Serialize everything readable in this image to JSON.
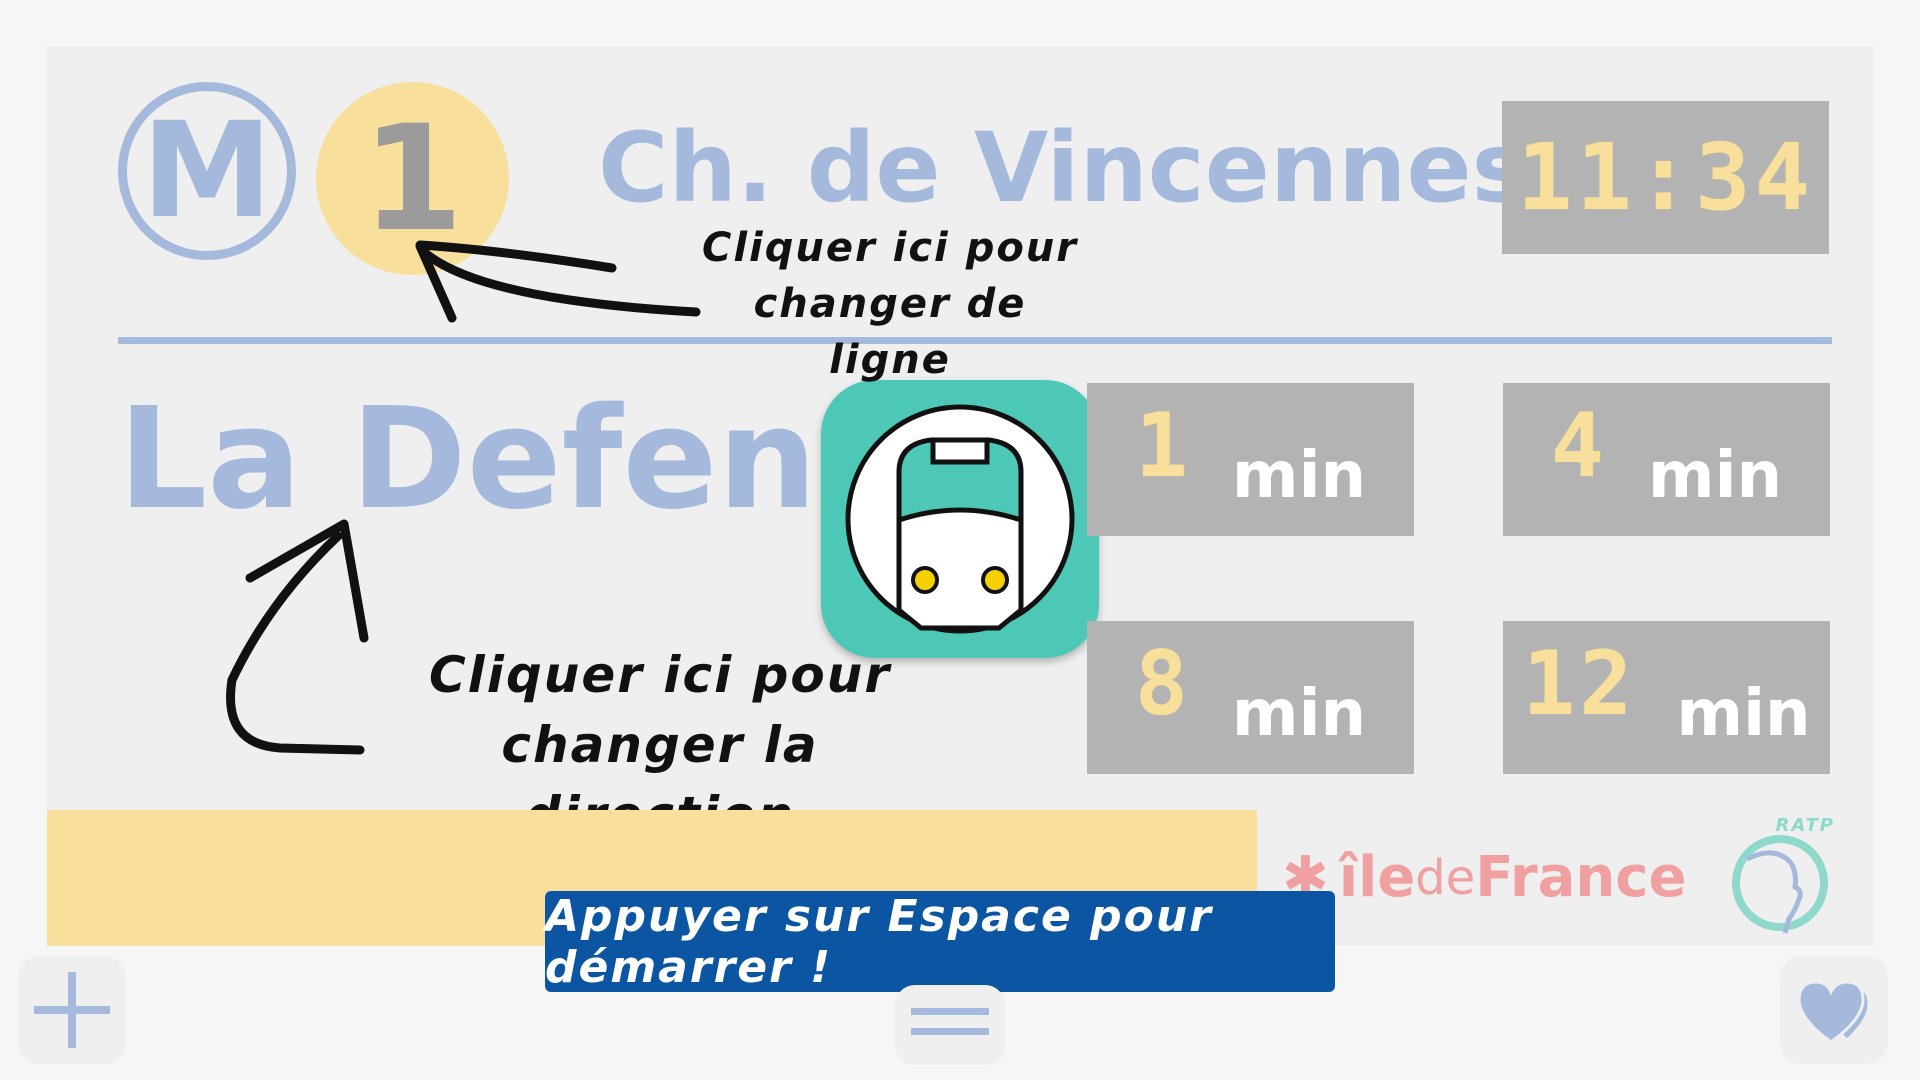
{
  "header": {
    "network_logo": "M",
    "line_number": "1",
    "station_name": "Ch. de Vincennes",
    "clock": "11:34"
  },
  "direction": {
    "name": "La Defense"
  },
  "departures": [
    {
      "value": "1",
      "unit": "min"
    },
    {
      "value": "4",
      "unit": "min"
    },
    {
      "value": "8",
      "unit": "min"
    },
    {
      "value": "12",
      "unit": "min"
    }
  ],
  "hints": {
    "line_hint": [
      "Cliquer ici pour",
      "changer de ligne"
    ],
    "direction_hint": [
      "Cliquer ici pour",
      "changer la direction"
    ]
  },
  "footer": {
    "start_banner": "Appuyer sur Espace pour démarrer !",
    "idf_logo_text": [
      "île",
      "de",
      "France"
    ],
    "ratp_logo_text": "RATP"
  },
  "icons": {
    "add": "plus-icon",
    "menu": "hamburger-icon",
    "favorites": "hearts-icon",
    "app": "train-icon"
  },
  "colors": {
    "accent_blue": "#a5b9dc",
    "line_yellow": "#f8df9c",
    "board_grey": "#b3b3b3",
    "banner_blue": "#0b55a3",
    "app_teal": "#4dc8b6",
    "idf_red": "#f0a0a0"
  }
}
